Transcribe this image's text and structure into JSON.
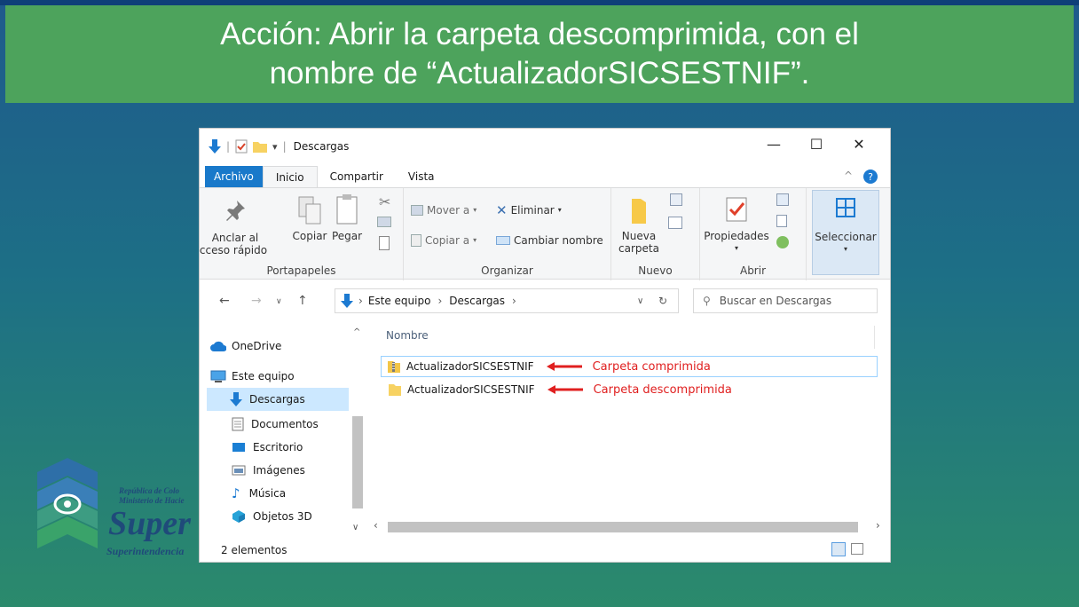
{
  "slide": {
    "title_line1": "Acción: Abrir la carpeta descomprimida, con el",
    "title_line2": "nombre de “ActualizadorSICSESTNIF”."
  },
  "logo": {
    "line1": "República de Colo",
    "line2": "Ministerio de Hacie",
    "big": "Super",
    "bottom": "Superintendencia"
  },
  "window": {
    "title": "Descargas",
    "controls": {
      "minimize": "—",
      "maximize": "☐",
      "close": "✕"
    },
    "tabs": [
      "Archivo",
      "Inicio",
      "Compartir",
      "Vista"
    ],
    "ribbon": {
      "portapapeles": {
        "label": "Portapapeles",
        "anclar_line1": "Anclar al",
        "anclar_line2": "Acceso rápido",
        "copiar": "Copiar",
        "pegar": "Pegar"
      },
      "organizar": {
        "label": "Organizar",
        "mover": "Mover a",
        "copiar_a": "Copiar a",
        "eliminar": "Eliminar",
        "cambiar": "Cambiar nombre"
      },
      "nuevo": {
        "label": "Nuevo",
        "carpeta_line1": "Nueva",
        "carpeta_line2": "carpeta"
      },
      "abrir": {
        "label": "Abrir",
        "propiedades": "Propiedades"
      },
      "seleccionar": {
        "label": "Seleccionar"
      }
    },
    "address": {
      "crumbs": [
        "Este equipo",
        "Descargas"
      ],
      "search_placeholder": "Buscar en Descargas"
    },
    "sidebar": [
      {
        "label": "OneDrive",
        "icon": "cloud-icon"
      },
      {
        "label": "Este equipo",
        "icon": "computer-icon"
      },
      {
        "label": "Descargas",
        "icon": "download-icon",
        "selected": true
      },
      {
        "label": "Documentos",
        "icon": "document-icon"
      },
      {
        "label": "Escritorio",
        "icon": "desktop-icon"
      },
      {
        "label": "Imágenes",
        "icon": "image-icon"
      },
      {
        "label": "Música",
        "icon": "music-icon"
      },
      {
        "label": "Objetos 3D",
        "icon": "cube-icon"
      }
    ],
    "files": {
      "column_name": "Nombre",
      "rows": [
        {
          "name": "ActualizadorSICSESTNIF",
          "note": "Carpeta comprimida",
          "type": "zip-folder"
        },
        {
          "name": "ActualizadorSICSESTNIF",
          "note": "Carpeta descomprimida",
          "type": "folder"
        }
      ]
    },
    "status": "2 elementos",
    "colors": {
      "accent": "#1979ca",
      "note": "#e02020",
      "banner": "#4da35c"
    }
  }
}
